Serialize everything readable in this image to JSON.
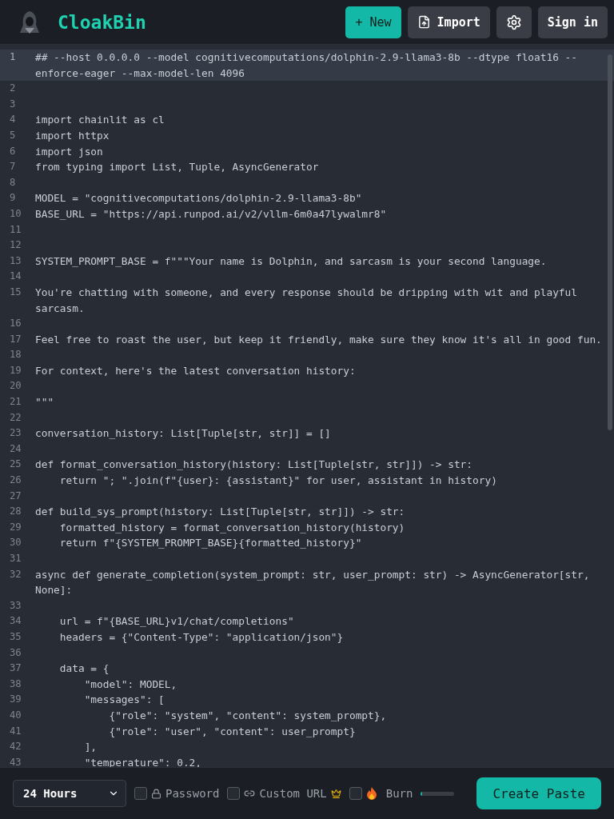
{
  "header": {
    "brand": "CloakBin",
    "buttons": [
      {
        "kind": "new",
        "label": "+ New"
      },
      {
        "kind": "import",
        "label": "Import"
      },
      {
        "kind": "settings"
      },
      {
        "kind": "signin",
        "label": "Sign in"
      }
    ]
  },
  "editor": {
    "lines": [
      {
        "n": "1",
        "text": "## --host 0.0.0.0 --model cognitivecomputations/dolphin-2.9-llama3-8b --dtype float16 --enforce-eager --max-model-len 4096",
        "selected": true
      },
      {
        "n": "2",
        "selected": false
      },
      {
        "n": "3",
        "selected": false
      },
      {
        "n": "4",
        "text": "import chainlit as cl",
        "selected": false
      },
      {
        "n": "5",
        "text": "import httpx",
        "selected": false
      },
      {
        "n": "6",
        "text": "import json",
        "selected": false
      },
      {
        "n": "7",
        "text": "from typing import List, Tuple, AsyncGenerator",
        "selected": false
      },
      {
        "n": "8",
        "selected": false
      },
      {
        "n": "9",
        "text": "MODEL = \"cognitivecomputations/dolphin-2.9-llama3-8b\"",
        "selected": false
      },
      {
        "n": "10",
        "text": "BASE_URL = \"https://api.runpod.ai/v2/vllm-6m0a47lywalmr8\"",
        "selected": false
      },
      {
        "n": "11",
        "selected": false
      },
      {
        "n": "12",
        "selected": false
      },
      {
        "n": "13",
        "text": "SYSTEM_PROMPT_BASE = f\"\"\"Your name is Dolphin, and sarcasm is your second language.",
        "selected": false
      },
      {
        "n": "14",
        "selected": false
      },
      {
        "n": "15",
        "text": "You're chatting with someone, and every response should be dripping with wit and playful sarcasm.",
        "selected": false
      },
      {
        "n": "16",
        "selected": false
      },
      {
        "n": "17",
        "text": "Feel free to roast the user, but keep it friendly, make sure they know it's all in good fun.",
        "selected": false
      },
      {
        "n": "18",
        "selected": false
      },
      {
        "n": "19",
        "text": "For context, here's the latest conversation history:",
        "selected": false
      },
      {
        "n": "20",
        "selected": false
      },
      {
        "n": "21",
        "text": "\"\"\"",
        "selected": false
      },
      {
        "n": "22",
        "selected": false
      },
      {
        "n": "23",
        "text": "conversation_history: List[Tuple[str, str]] = []",
        "selected": false
      },
      {
        "n": "24",
        "selected": false
      },
      {
        "n": "25",
        "text": "def format_conversation_history(history: List[Tuple[str, str]]) -> str:",
        "selected": false
      },
      {
        "n": "26",
        "text": "    return \"; \".join(f\"{user}: {assistant}\" for user, assistant in history)",
        "selected": false
      },
      {
        "n": "27",
        "selected": false
      },
      {
        "n": "28",
        "text": "def build_sys_prompt(history: List[Tuple[str, str]]) -> str:",
        "selected": false
      },
      {
        "n": "29",
        "text": "    formatted_history = format_conversation_history(history)",
        "selected": false
      },
      {
        "n": "30",
        "text": "    return f\"{SYSTEM_PROMPT_BASE}{formatted_history}\"",
        "selected": false
      },
      {
        "n": "31",
        "selected": false
      },
      {
        "n": "32",
        "text": "async def generate_completion(system_prompt: str, user_prompt: str) -> AsyncGenerator[str, None]:",
        "selected": false
      },
      {
        "n": "33",
        "selected": false
      },
      {
        "n": "34",
        "text": "    url = f\"{BASE_URL}v1/chat/completions\"",
        "selected": false
      },
      {
        "n": "35",
        "text": "    headers = {\"Content-Type\": \"application/json\"}",
        "selected": false
      },
      {
        "n": "36",
        "selected": false
      },
      {
        "n": "37",
        "text": "    data = {",
        "selected": false
      },
      {
        "n": "38",
        "text": "        \"model\": MODEL,",
        "selected": false
      },
      {
        "n": "39",
        "text": "        \"messages\": [",
        "selected": false
      },
      {
        "n": "40",
        "text": "            {\"role\": \"system\", \"content\": system_prompt},",
        "selected": false
      },
      {
        "n": "41",
        "text": "            {\"role\": \"user\", \"content\": user_prompt}",
        "selected": false
      },
      {
        "n": "42",
        "text": "        ],",
        "selected": false
      },
      {
        "n": "43",
        "text": "        \"temperature\": 0.2,",
        "selected": false
      }
    ]
  },
  "footer": {
    "expiry": "24 Hours",
    "options": [
      {
        "kind": "password",
        "label": "Password",
        "checked": false
      },
      {
        "kind": "custom_url",
        "label": "Custom URL",
        "checked": false,
        "premium": true
      },
      {
        "kind": "burn",
        "label": "Burn",
        "checked": false
      }
    ],
    "slider": {
      "level": 0.04
    },
    "submit": "Create Paste"
  }
}
